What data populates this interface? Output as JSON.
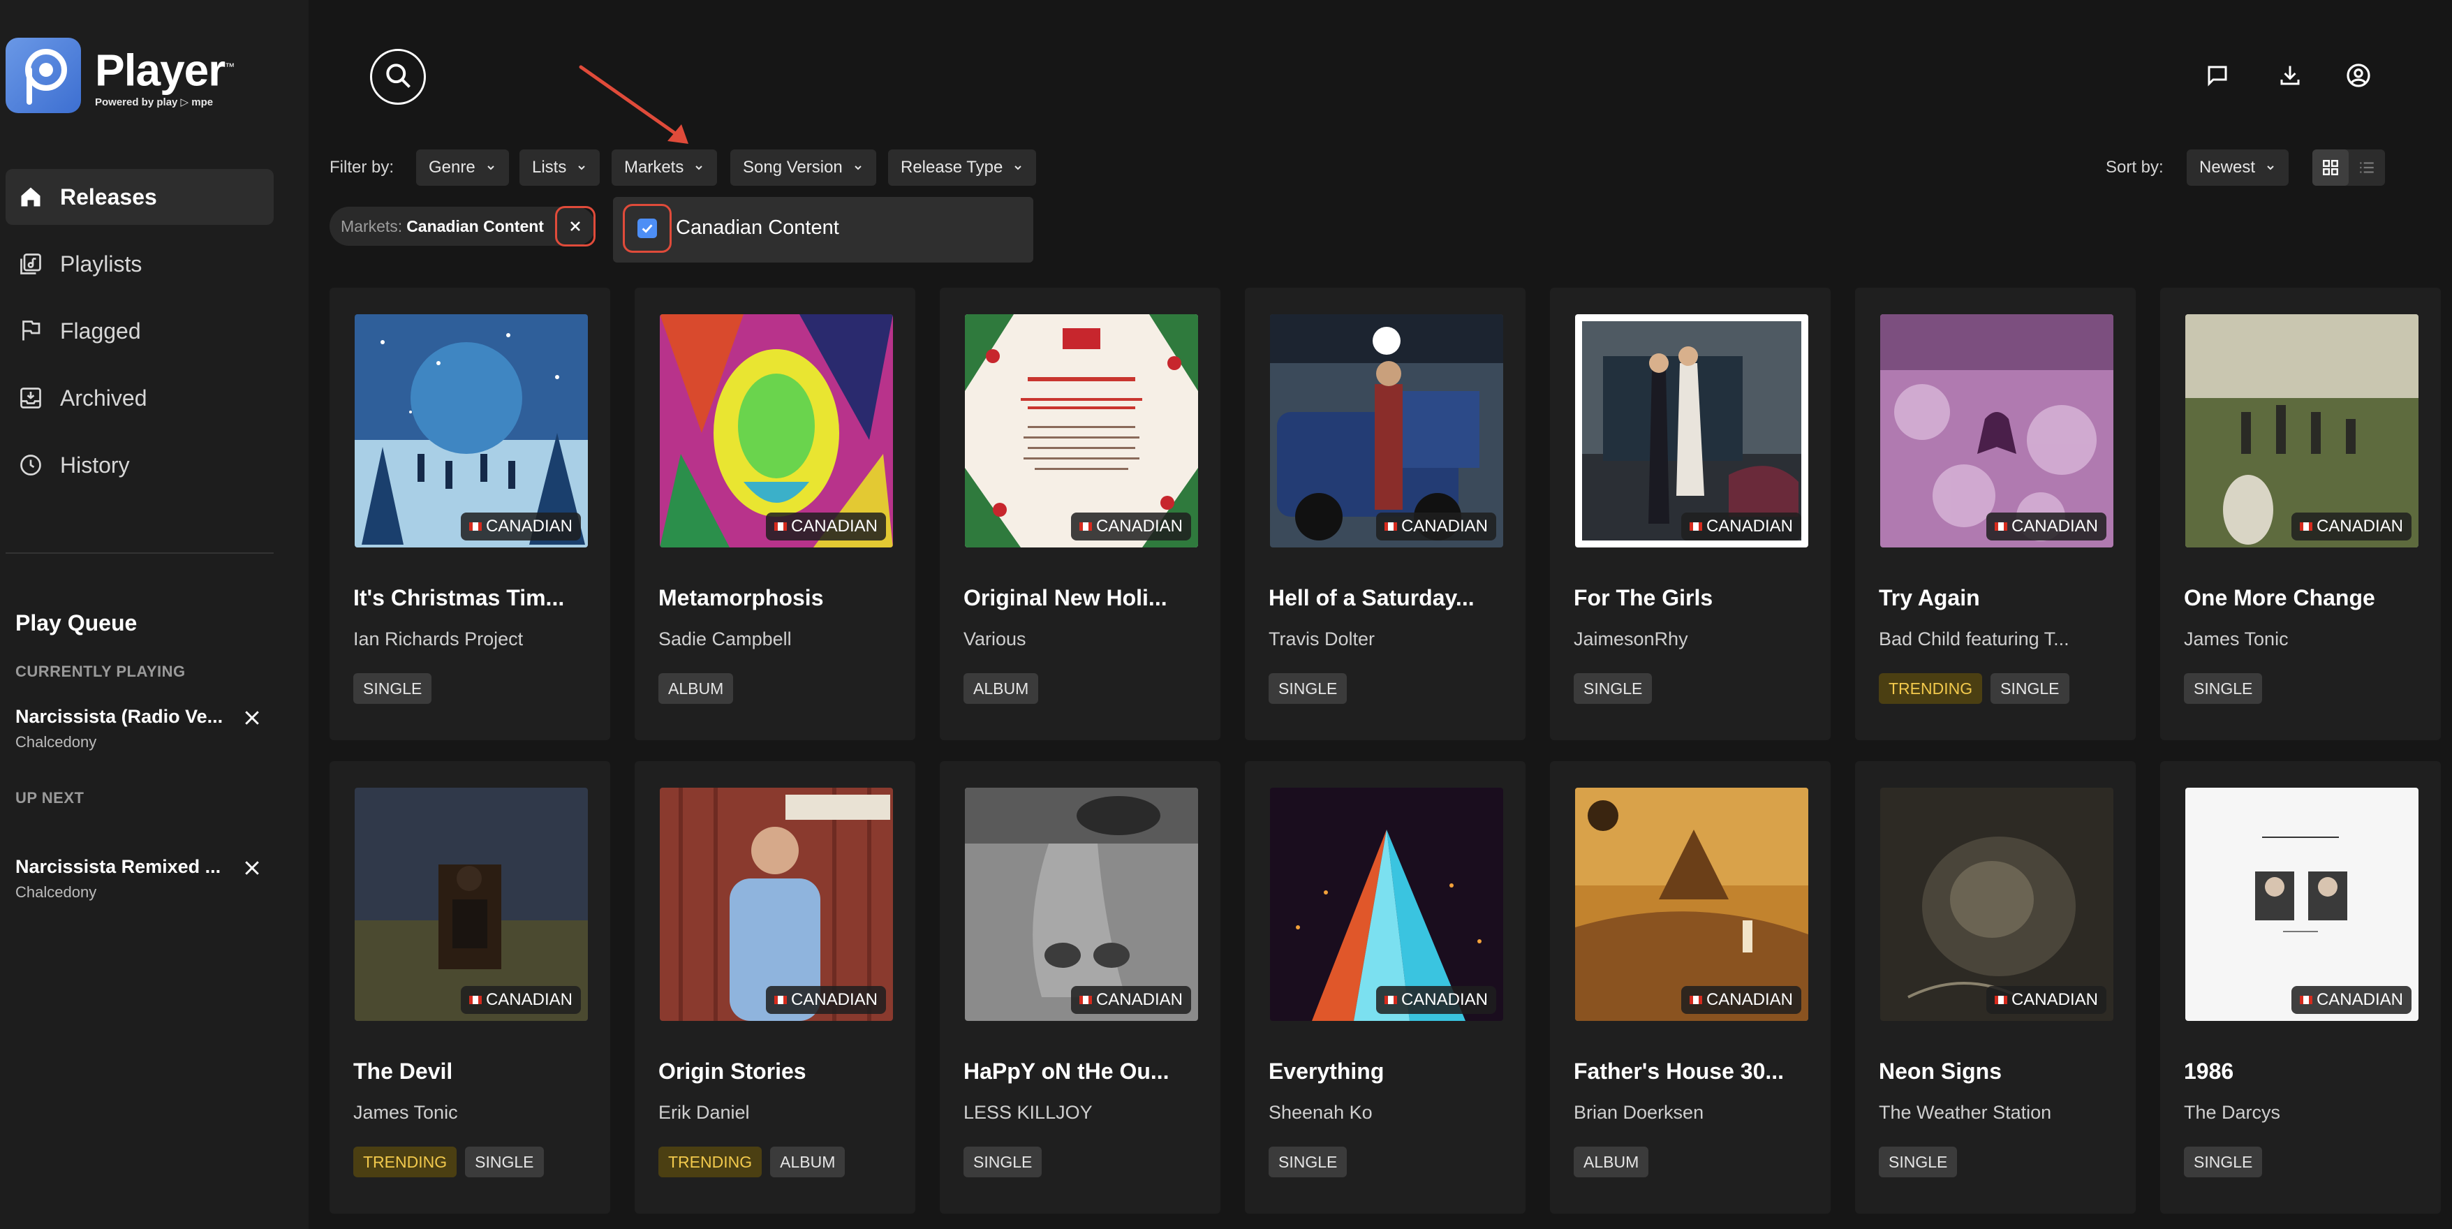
{
  "app": {
    "name": "Player",
    "trademark": "™",
    "powered_by": "Powered by play ▷ mpe"
  },
  "nav": [
    {
      "label": "Releases",
      "icon": "home-icon",
      "active": true
    },
    {
      "label": "Playlists",
      "icon": "playlist-icon",
      "active": false
    },
    {
      "label": "Flagged",
      "icon": "flag-icon",
      "active": false
    },
    {
      "label": "Archived",
      "icon": "archive-icon",
      "active": false
    },
    {
      "label": "History",
      "icon": "clock-icon",
      "active": false
    }
  ],
  "queue": {
    "title": "Play Queue",
    "currently_playing_label": "CURRENTLY PLAYING",
    "current": {
      "name": "Narcissista (Radio Ve...",
      "artist": "Chalcedony"
    },
    "up_next_label": "UP NEXT",
    "next": {
      "name": "Narcissista Remixed ...",
      "artist": "Chalcedony"
    }
  },
  "filters": {
    "label": "Filter by:",
    "genre": "Genre",
    "lists": "Lists",
    "markets": "Markets",
    "song_version": "Song Version",
    "release_type": "Release Type",
    "active_chip_key": "Markets:",
    "active_chip_value": "Canadian Content",
    "menu_option": "Canadian Content"
  },
  "sort": {
    "label": "Sort by:",
    "value": "Newest"
  },
  "badge_label": "CANADIAN",
  "releases": [
    {
      "title": "It's Christmas Tim...",
      "artist": "Ian Richards Project",
      "tags": [
        "SINGLE"
      ]
    },
    {
      "title": "Metamorphosis",
      "artist": "Sadie Campbell",
      "tags": [
        "ALBUM"
      ]
    },
    {
      "title": "Original New Holi...",
      "artist": "Various",
      "tags": [
        "ALBUM"
      ]
    },
    {
      "title": "Hell of a Saturday...",
      "artist": "Travis Dolter",
      "tags": [
        "SINGLE"
      ]
    },
    {
      "title": "For The Girls",
      "artist": "JaimesonRhy",
      "tags": [
        "SINGLE"
      ]
    },
    {
      "title": "Try Again",
      "artist": "Bad Child featuring T...",
      "tags": [
        "TRENDING",
        "SINGLE"
      ]
    },
    {
      "title": "One More Change",
      "artist": "James Tonic",
      "tags": [
        "SINGLE"
      ]
    },
    {
      "title": "The Devil",
      "artist": "James Tonic",
      "tags": [
        "TRENDING",
        "SINGLE"
      ]
    },
    {
      "title": "Origin Stories",
      "artist": "Erik Daniel",
      "tags": [
        "TRENDING",
        "ALBUM"
      ]
    },
    {
      "title": "HaPpY oN tHe Ou...",
      "artist": "LESS KILLJOY",
      "tags": [
        "SINGLE"
      ]
    },
    {
      "title": "Everything",
      "artist": "Sheenah Ko",
      "tags": [
        "SINGLE"
      ]
    },
    {
      "title": "Father's House 30...",
      "artist": "Brian Doerksen",
      "tags": [
        "ALBUM"
      ]
    },
    {
      "title": "Neon Signs",
      "artist": "The Weather Station",
      "tags": [
        "SINGLE"
      ]
    },
    {
      "title": "1986",
      "artist": "The Darcys",
      "tags": [
        "SINGLE"
      ]
    }
  ],
  "colors": {
    "background": "#161616",
    "sidebar": "#1d1d1d",
    "card": "#1f1f1f",
    "accent_blue": "#4d8ef5",
    "highlight_red": "#e04b3a",
    "trending_text": "#f2c94c"
  }
}
